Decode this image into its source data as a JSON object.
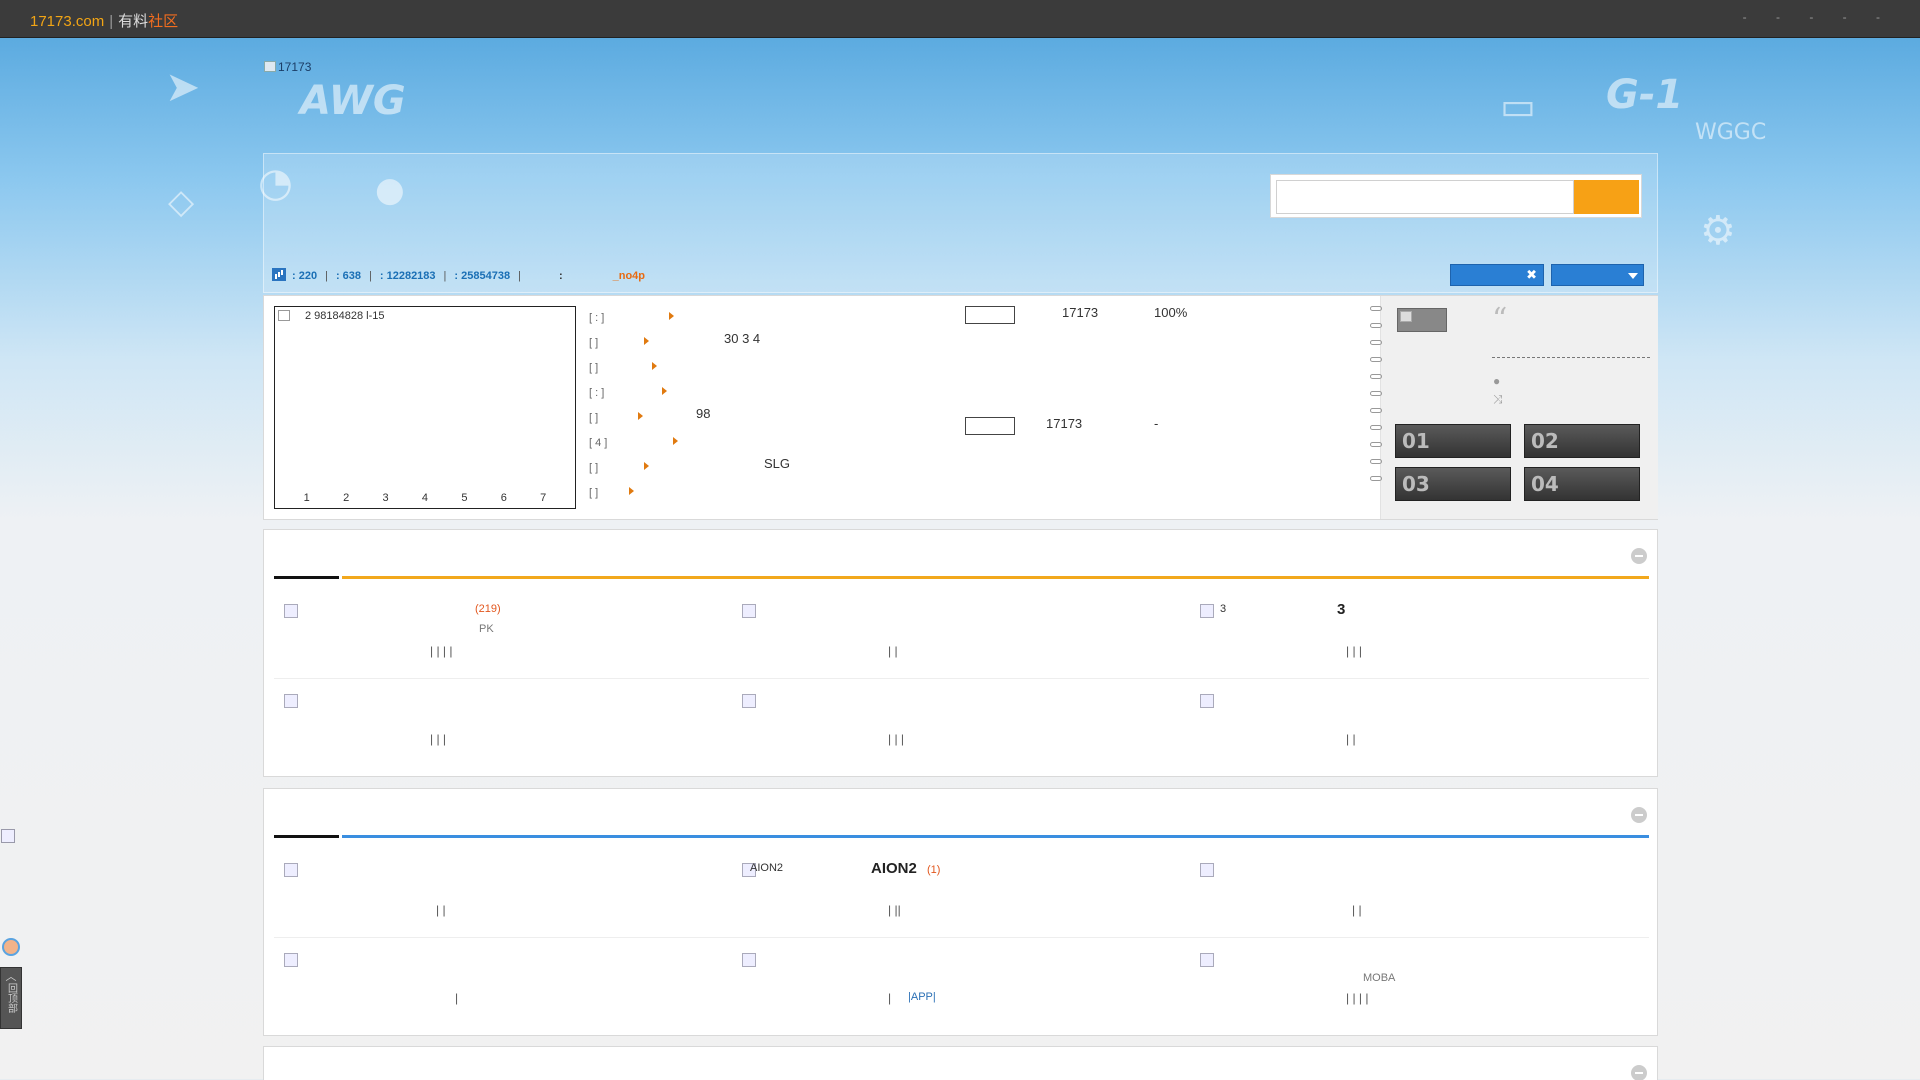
{
  "topbar": {
    "brand_site": "17173.com",
    "brand_sep": "|",
    "brand_a": "有料",
    "brand_b": "社区",
    "links": [
      "-",
      "-",
      "-",
      "-",
      "-"
    ]
  },
  "header": {
    "logo_alt": "17173",
    "search_placeholder": "",
    "search_button_label": ""
  },
  "stats": {
    "today": ": 220",
    "yesterday": ": 638",
    "posts": ": 12282183",
    "members": ": 25854738",
    "newest_label": ":",
    "newest_user": "_no4p"
  },
  "slider": {
    "caption": "2 98184828 l-15",
    "pages": [
      "1",
      "2",
      "3",
      "4",
      "5",
      "6",
      "7"
    ]
  },
  "news": [
    {
      "tag": "[ : ]",
      "text": ""
    },
    {
      "tag": "[ ]",
      "text": "30 3 4"
    },
    {
      "tag": "[ ]",
      "text": ""
    },
    {
      "tag": "[ : ]",
      "text": ""
    },
    {
      "tag": "[ ]",
      "text": "98"
    },
    {
      "tag": "[ 4 ]",
      "text": ""
    },
    {
      "tag": "[ ]",
      "text": "SLG"
    },
    {
      "tag": "[ ]",
      "text": ""
    }
  ],
  "game_cards": [
    {
      "name": "17173",
      "value": "100%"
    },
    {
      "name": "17173",
      "value": "-"
    }
  ],
  "ranks": [
    "01",
    "02",
    "03",
    "04"
  ],
  "colors": {
    "accent_orange": "#f7a115",
    "accent_blue": "#2a7fd4",
    "section1_line": "#f2a81d",
    "section2_line": "#3a8ee0"
  },
  "section1": {
    "row1": [
      {
        "count": "(219)",
        "small": "PK",
        "pipes": "| | | |"
      },
      {
        "pipes": "| |"
      },
      {
        "alt": "3",
        "title": "3",
        "pipes": "| | |"
      }
    ],
    "row2": [
      {
        "pipes": "| | |"
      },
      {
        "pipes": "| | |"
      },
      {
        "pipes": "| |"
      }
    ]
  },
  "section2": {
    "row1": [
      {
        "pipes": "| |"
      },
      {
        "alt": "AION2",
        "title": "AION2",
        "count": "(1)",
        "pipes": "| ||"
      },
      {
        "pipes": "| |"
      }
    ],
    "row2": [
      {
        "pipes": "|"
      },
      {
        "pipes": "|",
        "link": "|APP|"
      },
      {
        "small": "MOBA",
        "pipes": "| | | |"
      }
    ]
  },
  "backtop_label": "回顶部"
}
